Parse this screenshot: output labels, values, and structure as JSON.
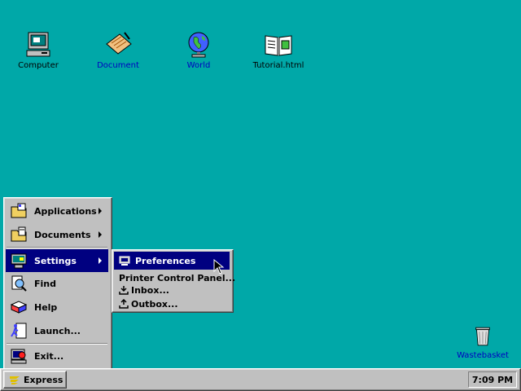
{
  "desktop": {
    "icons": [
      {
        "label": "Computer",
        "icon": "computer-icon"
      },
      {
        "label": "Document",
        "icon": "document-icon"
      },
      {
        "label": "World",
        "icon": "globe-icon"
      },
      {
        "label": "Tutorial.html",
        "icon": "book-icon"
      },
      {
        "label": "Wastebasket",
        "icon": "wastebasket-icon"
      }
    ]
  },
  "start_menu": {
    "items": [
      {
        "label": "Applications",
        "icon": "applications-icon",
        "has_submenu": true
      },
      {
        "label": "Documents",
        "icon": "documents-icon",
        "has_submenu": true
      },
      {
        "label": "Settings",
        "icon": "settings-icon",
        "has_submenu": true,
        "selected": true
      },
      {
        "label": "Find",
        "icon": "find-icon"
      },
      {
        "label": "Help",
        "icon": "help-icon"
      },
      {
        "label": "Launch...",
        "icon": "launch-icon"
      },
      {
        "label": "Exit...",
        "icon": "exit-icon"
      }
    ]
  },
  "settings_submenu": {
    "items": [
      {
        "label": "Preferences",
        "icon": "preferences-icon",
        "selected": true
      },
      {
        "label": "Printer Control Panel..."
      },
      {
        "label": "Inbox...",
        "icon": "inbox-icon"
      },
      {
        "label": "Outbox...",
        "icon": "outbox-icon"
      }
    ]
  },
  "taskbar": {
    "start_label": "Express",
    "clock": "7:09 PM"
  },
  "colors": {
    "desktop": "#00a8a8",
    "highlight": "#000080",
    "chrome": "#c0c0c0"
  }
}
